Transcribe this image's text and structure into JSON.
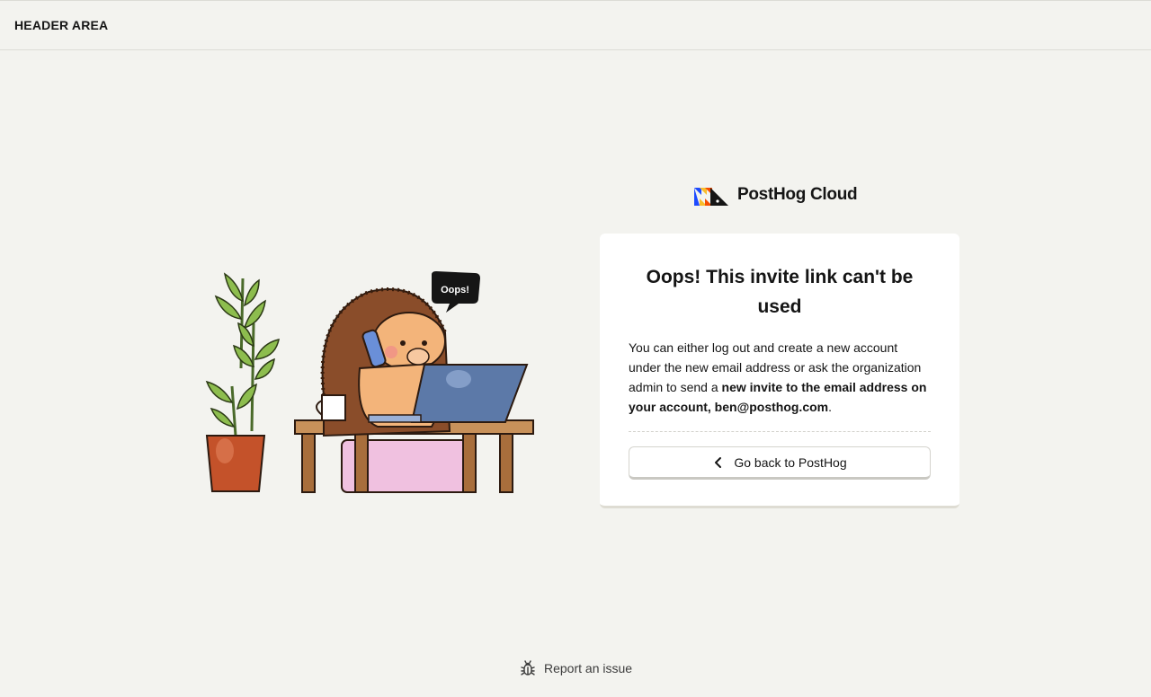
{
  "header": {
    "title": "HEADER AREA"
  },
  "brand": {
    "name": "PostHog Cloud",
    "logo_icon": "posthog-logo-icon"
  },
  "illustration": {
    "speech_bubble": "Oops!"
  },
  "card": {
    "title": "Oops! This invite link can't be used",
    "body_intro": "You can either log out and create a new account under the new email address or ask the organization admin to send a ",
    "body_bold": "new invite to the email address on your account, ben@posthog.com",
    "body_end": "."
  },
  "back_button": {
    "label": "Go back to PostHog",
    "icon": "chevron-left-icon"
  },
  "footer": {
    "report_label": "Report an issue",
    "icon": "bug-icon"
  },
  "colors": {
    "background": "#f3f3ef",
    "card": "#ffffff",
    "logo_blue": "#1d4aff",
    "logo_yellow": "#f9bd2b",
    "logo_red": "#f54e00"
  }
}
